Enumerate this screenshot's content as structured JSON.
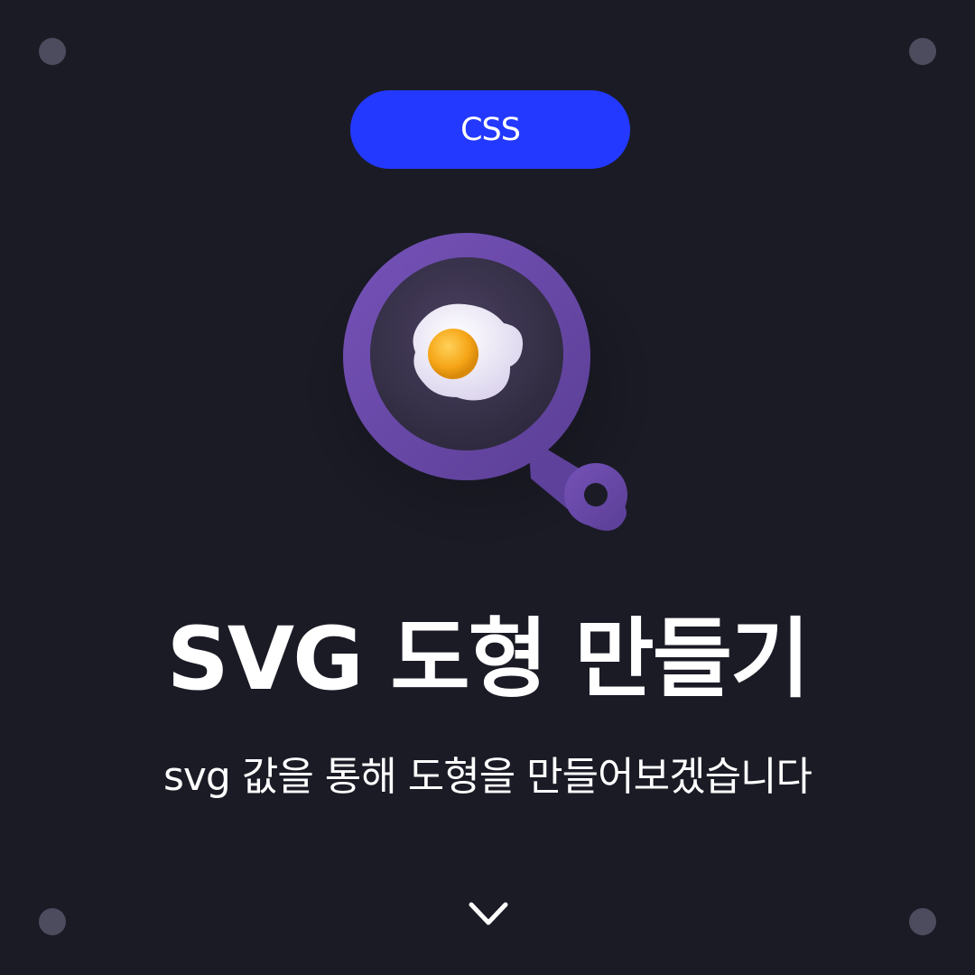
{
  "badge": {
    "label": "CSS"
  },
  "heading": {
    "title": "SVG 도형 만들기",
    "subtitle": "svg 값을 통해 도형을 만들어보겠습니다"
  },
  "illustration": {
    "icon": "frying-pan-with-egg"
  },
  "navigation": {
    "icon": "chevron-down-icon"
  },
  "colors": {
    "background": "#1b1b26",
    "badge": "#2339ff",
    "pan": "#6a4aa8",
    "corner_dots": "#4d4c5e",
    "egg_yolk": "#f5a516"
  }
}
